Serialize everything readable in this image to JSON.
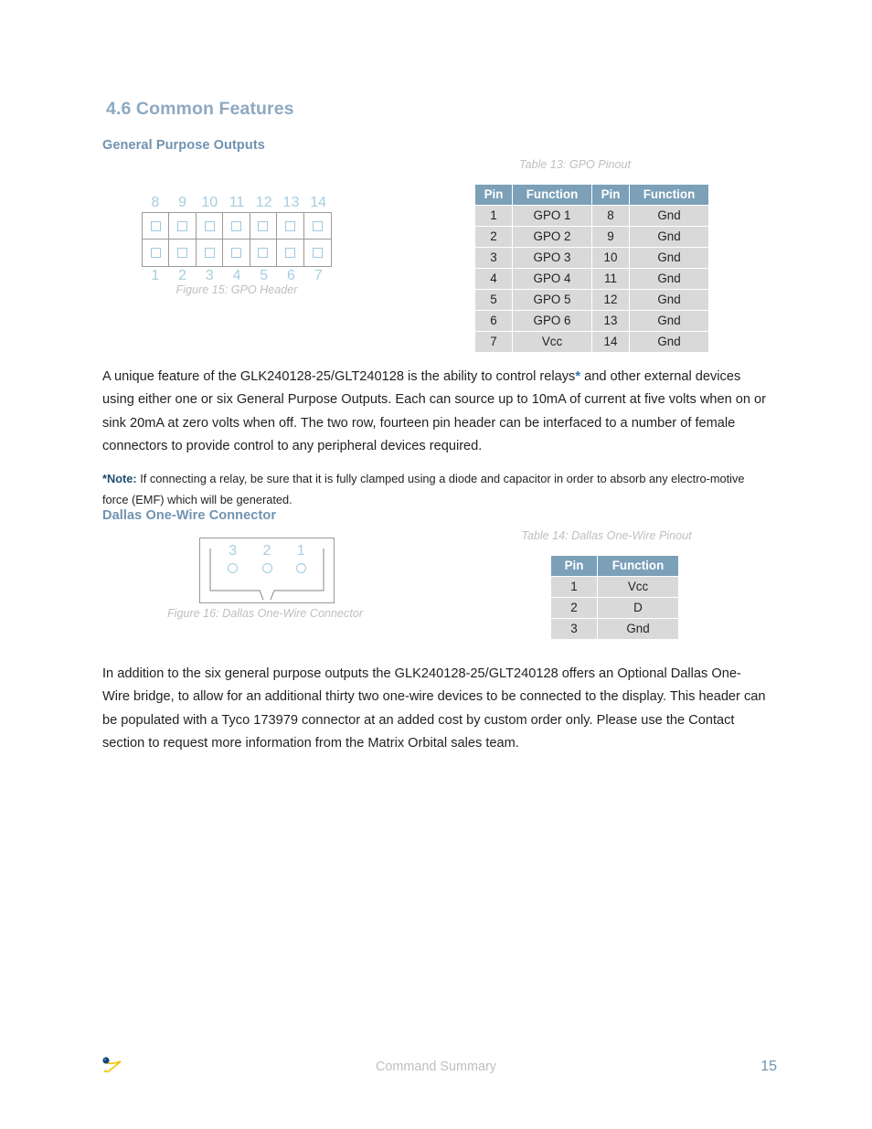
{
  "section": {
    "number_title": "4.6 Common Features"
  },
  "gpo": {
    "subheading": "General Purpose Outputs",
    "table_caption": "Table 13: GPO Pinout",
    "figure_caption": "Figure 15: GPO Header",
    "table": {
      "headers": [
        "Pin",
        "Function",
        "Pin",
        "Function"
      ],
      "rows": [
        [
          "1",
          "GPO 1",
          "8",
          "Gnd"
        ],
        [
          "2",
          "GPO 2",
          "9",
          "Gnd"
        ],
        [
          "3",
          "GPO 3",
          "10",
          "Gnd"
        ],
        [
          "4",
          "GPO 4",
          "11",
          "Gnd"
        ],
        [
          "5",
          "GPO 5",
          "12",
          "Gnd"
        ],
        [
          "6",
          "GPO 6",
          "13",
          "Gnd"
        ],
        [
          "7",
          "Vcc",
          "14",
          "Gnd"
        ]
      ]
    },
    "figure": {
      "top_pins": [
        "8",
        "9",
        "10",
        "11",
        "12",
        "13",
        "14"
      ],
      "bottom_pins": [
        "1",
        "2",
        "3",
        "4",
        "5",
        "6",
        "7"
      ]
    },
    "paragraph_pre_star": "A unique feature of the GLK240128-25/GLT240128 is the ability to control relays",
    "paragraph_star": "*",
    "paragraph_post_star": " and other external devices using either one or six General Purpose Outputs.  Each can source up to 10mA of current at five volts when on or sink 20mA at zero volts when off.  The two row, fourteen pin header can be interfaced to a number of female connectors to provide control to any peripheral devices required."
  },
  "note": {
    "label": "*Note:",
    "text": " If connecting a relay, be sure that it is fully clamped using a diode and capacitor in order to absorb any electro-motive force (EMF) which will be generated."
  },
  "dallas": {
    "subheading": "Dallas One-Wire Connector",
    "table_caption": "Table 14: Dallas One-Wire Pinout",
    "figure_caption": "Figure 16: Dallas One-Wire Connector",
    "table": {
      "headers": [
        "Pin",
        "Function"
      ],
      "rows": [
        [
          "1",
          "Vcc"
        ],
        [
          "2",
          "D"
        ],
        [
          "3",
          "Gnd"
        ]
      ]
    },
    "figure": {
      "pins": [
        "1",
        "2",
        "3"
      ]
    },
    "paragraph": "In addition to the six general purpose outputs the GLK240128-25/GLT240128 offers an Optional Dallas One-Wire bridge, to allow for an additional thirty two one-wire devices to be connected to the display.  This header can be populated with a Tyco 173979 connector at an added cost by custom order only.  Please use the Contact section to request more information from the Matrix Orbital sales team."
  },
  "footer": {
    "center_text": "Command Summary",
    "page_number": "15",
    "logo_name": "matrix-orbital-logo"
  },
  "colors": {
    "section_heading": "#8ea9c1",
    "sub_heading": "#6f93b1",
    "table_header_bg": "#7ba0b8",
    "table_cell_bg": "#d9d9d9",
    "caption": "#bfbfbf",
    "note_label": "#1f4e6e",
    "figure_accent": "#9fc9e0",
    "page_number": "#6f93b1"
  }
}
